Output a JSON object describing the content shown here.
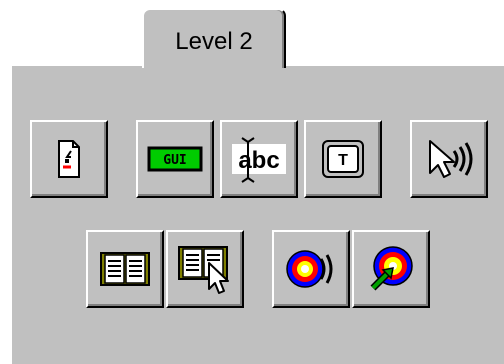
{
  "tab": {
    "label": "Level 2"
  },
  "buttons": {
    "row1": [
      {
        "name": "document-edit-button",
        "icon": "document-face-icon"
      },
      {
        "name": "gui-button",
        "icon": "gui-label-icon",
        "icon_text": "GUI"
      },
      {
        "name": "text-select-button",
        "icon": "text-cursor-abc-icon",
        "icon_text": "abc"
      },
      {
        "name": "text-field-button",
        "icon": "text-box-T-icon",
        "icon_text": "T"
      },
      {
        "name": "pointer-sound-button",
        "icon": "cursor-sound-icon"
      }
    ],
    "row2": [
      {
        "name": "book-button",
        "icon": "open-book-icon"
      },
      {
        "name": "book-pointer-button",
        "icon": "book-cursor-icon"
      },
      {
        "name": "target-sound-button",
        "icon": "target-sound-icon"
      },
      {
        "name": "target-arrow-button",
        "icon": "target-arrow-icon"
      }
    ]
  },
  "colors": {
    "face": "#c0c0c0",
    "gui_green": "#00cc00",
    "target_red": "#ff0000",
    "target_blue": "#0000ff",
    "target_yellow": "#ffff00",
    "arrow_green": "#00a000"
  }
}
